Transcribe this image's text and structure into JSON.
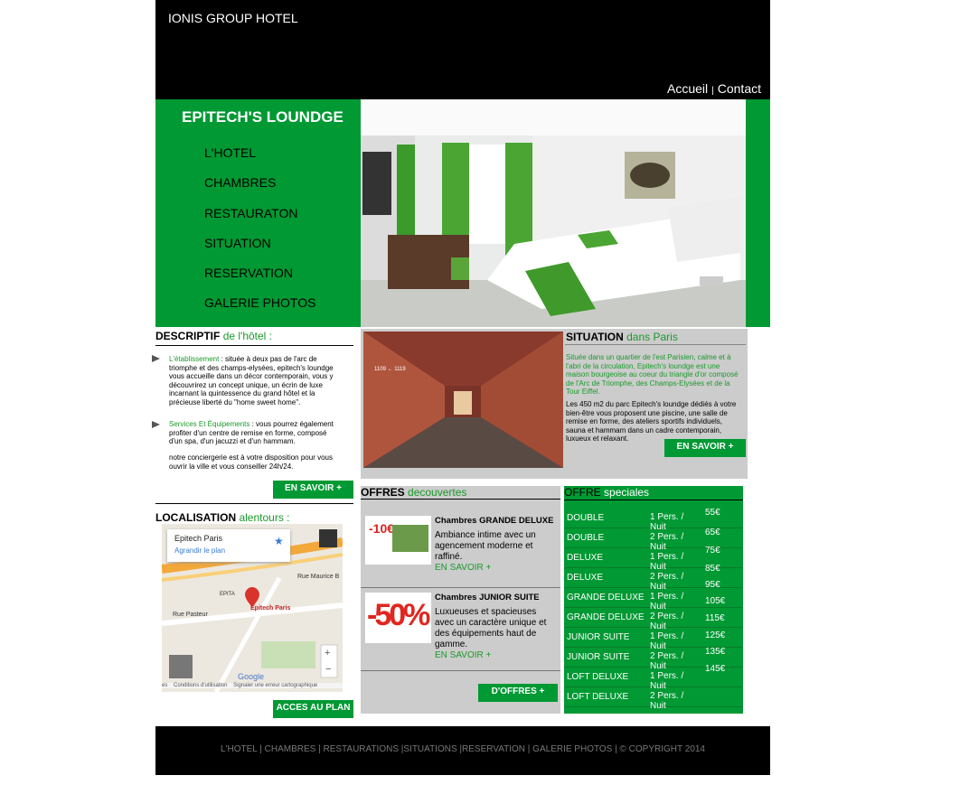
{
  "header": {
    "site_title": "IONIS GROUP HOTEL",
    "nav_home": "Accueil",
    "nav_sep": "|",
    "nav_contact": "Contact"
  },
  "sidebar": {
    "brand": "EPITECH'S LOUNDGE",
    "items": [
      {
        "label": "L'HOTEL"
      },
      {
        "label": "CHAMBRES"
      },
      {
        "label": "RESTAURATON"
      },
      {
        "label": "SITUATION"
      },
      {
        "label": "RESERVATION"
      },
      {
        "label": "GALERIE PHOTOS"
      }
    ]
  },
  "descriptif": {
    "title": "DESCRIPTIF",
    "title_accent": "de l'hôtel :",
    "p1_lead": "L'établissement",
    "p1_text": " : située à deux pas de l'arc de triomphe et des champs-elysées, epitech's loundge vous accueille dans un décor contemporain, vous y découvrirez un concept unique, un écrin de luxe incarnant la quintessence du grand hôtel et la précieuse liberté du \"home sweet home\".",
    "p2_lead": "Services Et Équipements",
    "p2_text": " : vous pourrez également profiter d'un centre de remise en forme, composé d'un spa, d'un jacuzzi et d'un hammam.",
    "p3_text": "notre conciergerie est à votre disposition pour vous ouvrir la ville et vous conseiller 24h/24.",
    "button": "EN SAVOIR +"
  },
  "situation": {
    "title": "SITUATION",
    "title_accent": "dans Paris",
    "p1": "Située dans un quartier de l'est Parisien, calme et à l'abri de la circulation, Epitech's loundge est une maison bourgeoise au coeur du triangle d'or composé de l'Arc de Triomphe, des Champs-Elysées et de la Tour Eiffel.",
    "p2": "Les 450 m2 du parc Epitech's loundge dédiés à votre bien-être vous proposent une piscine, une salle de remise en forme, des ateliers sportifs individuels, sauna et hammam dans un cadre contemporain, luxueux et relaxant.",
    "button": "EN SAVOIR +",
    "photo_text": "1109 ← 1119"
  },
  "localisation": {
    "title": "LOCALISATION",
    "title_accent": "alentours :",
    "map_place": "Epitech Paris",
    "map_enlarge": "Agrandir le plan",
    "map_marker": "Epitech Paris",
    "map_footer": "es    Conditions d'utilisation    Signaler une erreur cartographique",
    "map_google": "Google",
    "street1": "Rue Pasteur",
    "street2": "Rue Maurice B",
    "street3": "EPITA",
    "button": "ACCES AU PLAN"
  },
  "offres": {
    "title": "OFFRES",
    "title_accent": "decouvertes",
    "items": [
      {
        "title": "Chambres GRANDE DELUXE",
        "desc": "Ambiance intime avec un agencement moderne et raffiné.",
        "link": "EN SAVOIR +",
        "promo": "-10€"
      },
      {
        "title": "Chambres JUNIOR SUITE",
        "desc": "Luxueuses et spacieuses avec un caractère unique et des équipements haut de gamme.",
        "link": "EN SAVOIR +",
        "promo": "-50%"
      }
    ],
    "button": "D'OFFRES +"
  },
  "speciales": {
    "title": "OFFRE",
    "title_accent": "speciales",
    "rows": [
      {
        "type": "DOUBLE",
        "pers": "1 Pers. / Nuit",
        "price": "55€"
      },
      {
        "type": "DOUBLE",
        "pers": "2 Pers. / Nuit",
        "price": "65€"
      },
      {
        "type": "DELUXE",
        "pers": "1 Pers. / Nuit",
        "price": "75€"
      },
      {
        "type": "DELUXE",
        "pers": "2 Pers. / Nuit",
        "price": "85€"
      },
      {
        "type": "GRANDE DELUXE",
        "pers": "1 Pers. / Nuit",
        "price": "95€"
      },
      {
        "type": "GRANDE DELUXE",
        "pers": "2 Pers. / Nuit",
        "price": "105€"
      },
      {
        "type": "JUNIOR SUITE",
        "pers": "1 Pers. / Nuit",
        "price": "115€"
      },
      {
        "type": "JUNIOR SUITE",
        "pers": "2 Pers. / Nuit",
        "price": "125€"
      },
      {
        "type": "LOFT DELUXE",
        "pers": "1 Pers. / Nuit",
        "price": "135€"
      },
      {
        "type": "LOFT DELUXE",
        "pers": "2 Pers. / Nuit",
        "price": "145€"
      }
    ]
  },
  "footer": {
    "text": "L'HOTEL | CHAMBRES | RESTAURATIONS |SITUATIONS |RESERVATION | GALERIE PHOTOS | © COPYRIGHT 2014"
  },
  "colors": {
    "brand_green": "#009933",
    "accent_text_green": "#1a9a2a",
    "panel_gray": "#cccccc",
    "header_black": "#000000"
  }
}
